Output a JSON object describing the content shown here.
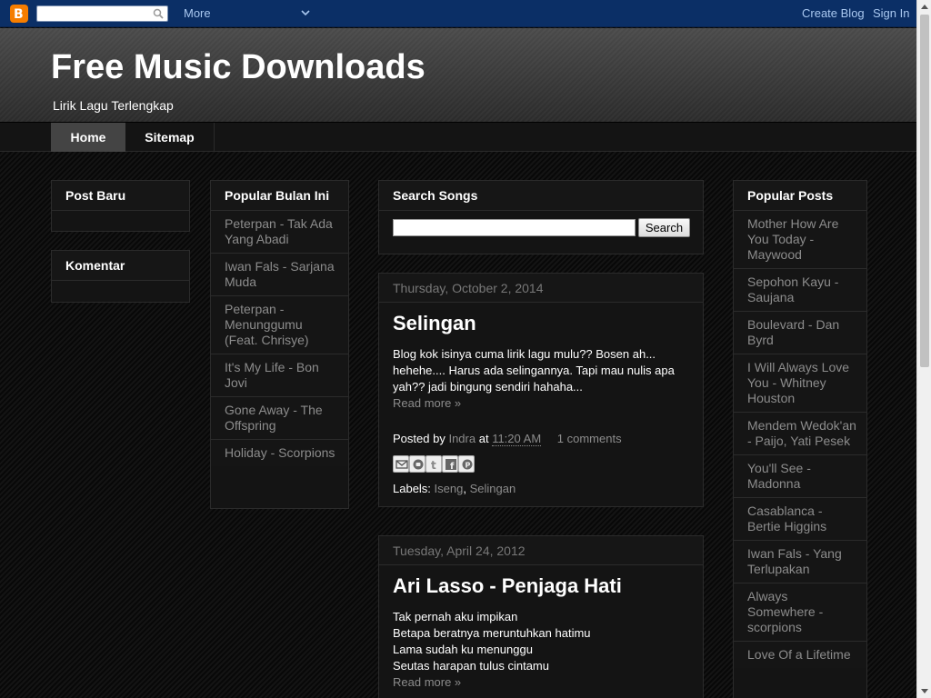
{
  "navbar": {
    "search_value": "",
    "more_label": "More",
    "create_blog_label": "Create Blog",
    "sign_in_label": "Sign In",
    "logo_letter": "B"
  },
  "header": {
    "title": "Free Music Downloads",
    "description": "Lirik Lagu Terlengkap"
  },
  "tabs": {
    "home": "Home",
    "sitemap": "Sitemap"
  },
  "widgets": {
    "post_baru_title": "Post Baru",
    "komentar_title": "Komentar",
    "popular_bulan_title": "Popular Bulan Ini",
    "popular_bulan_items": [
      "Peterpan - Tak Ada Yang Abadi",
      "Iwan Fals - Sarjana Muda",
      "Peterpan - Menunggumu (Feat. Chrisye)",
      "It's My Life - Bon Jovi",
      "Gone Away - The Offspring",
      "Holiday - Scorpions"
    ],
    "search_title": "Search Songs",
    "search_value": "",
    "search_button": "Search",
    "popular_posts_title": "Popular Posts",
    "popular_posts_items": [
      "Mother How Are You Today - Maywood",
      "Sepohon Kayu - Saujana",
      "Boulevard - Dan Byrd",
      "I Will Always Love You - Whitney Houston",
      "Mendem Wedok'an - Paijo, Yati Pesek",
      "You'll See - Madonna",
      "Casablanca - Bertie Higgins",
      "Iwan Fals - Yang Terlupakan",
      "Always Somewhere - scorpions",
      "Love Of a Lifetime"
    ]
  },
  "posts": [
    {
      "date": "Thursday, October 2, 2014",
      "title": "Selingan",
      "body": "Blog kok isinya cuma lirik lagu mulu?? Bosen ah... hehehe.... Harus ada selingannya. Tapi mau nulis apa yah?? jadi bingung sendiri hahaha...",
      "read_more": "Read more »",
      "posted_by_label": "Posted by",
      "author": "Indra",
      "at_label": "at",
      "time": "11:20 AM",
      "comments": "1 comments",
      "labels_label": "Labels:",
      "label1": "Iseng",
      "label_sep": ",",
      "label2": "Selingan"
    },
    {
      "date": "Tuesday, April 24, 2012",
      "title": "Ari Lasso - Penjaga Hati",
      "lines": [
        "Tak pernah aku impikan",
        "Betapa beratnya meruntuhkan hatimu",
        "Lama sudah ku menunggu",
        "Seutas harapan tulus cintamu"
      ],
      "read_more": "Read more »"
    }
  ],
  "share_icons": [
    "email-icon",
    "blogger-icon",
    "twitter-icon",
    "facebook-icon",
    "pinterest-icon"
  ]
}
